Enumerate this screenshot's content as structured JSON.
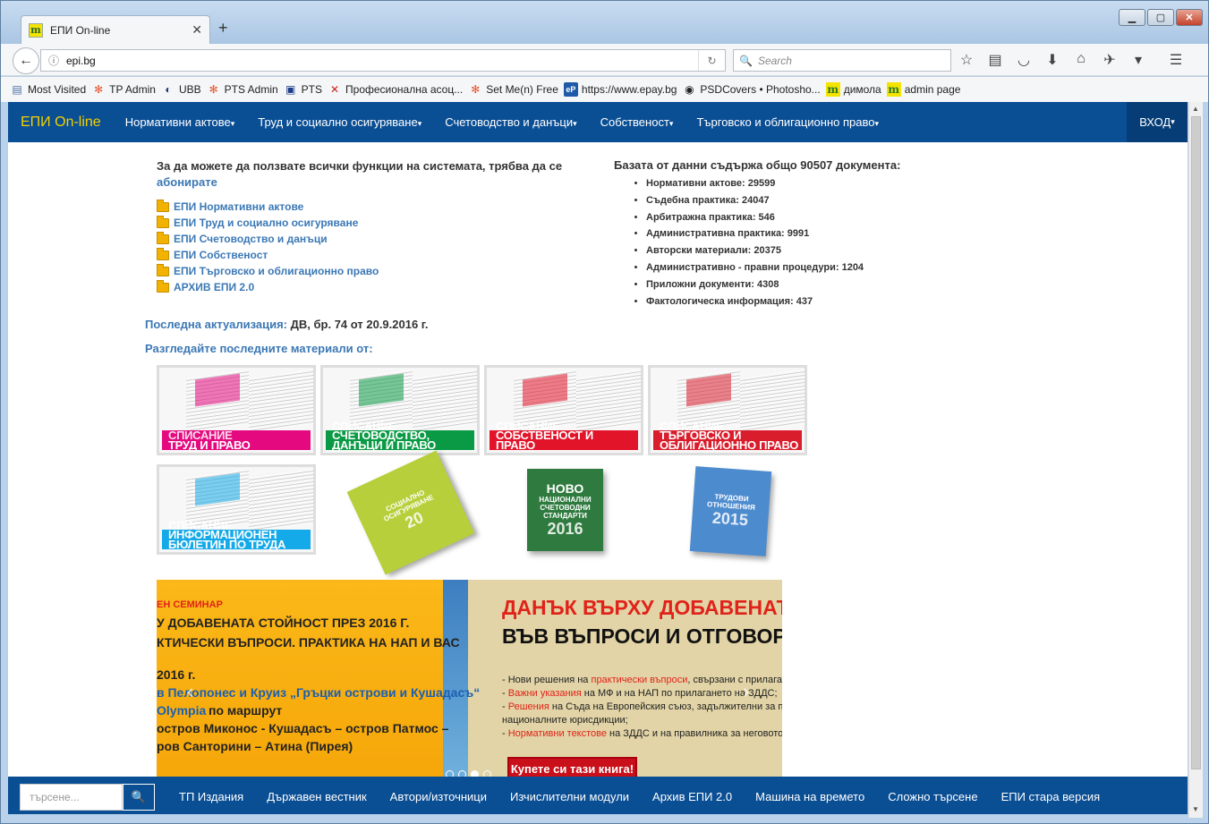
{
  "browser": {
    "tab_title": "ЕПИ On-line",
    "favicon": "m",
    "url": "epi.bg",
    "search_placeholder": "Search"
  },
  "bookmarks": [
    {
      "label": "Most Visited",
      "icon": "bookmark-icon"
    },
    {
      "label": "TP Admin",
      "icon": "joomla-icon"
    },
    {
      "label": "UBB",
      "icon": "ubb-icon"
    },
    {
      "label": "PTS Admin",
      "icon": "joomla-icon"
    },
    {
      "label": "PTS",
      "icon": "pts-icon"
    },
    {
      "label": "Професионална асоц...",
      "icon": "assoc-icon"
    },
    {
      "label": "Set Me(n) Free",
      "icon": "joomla-icon"
    },
    {
      "label": "https://www.epay.bg",
      "icon": "epay-icon"
    },
    {
      "label": "PSDCovers • Photosho...",
      "icon": "psd-icon"
    },
    {
      "label": "димола",
      "icon": "m-icon"
    },
    {
      "label": "admin page",
      "icon": "m-icon"
    }
  ],
  "header": {
    "brand": "ЕПИ On-line",
    "menu": [
      "Нормативни актове",
      "Труд и социално осигуряване",
      "Счетоводство и данъци",
      "Собственост",
      "Търговско и облигационно право"
    ],
    "login": "ВХОД"
  },
  "intro": {
    "text": "За да можете да ползвате всички функции на системата, трябва да се",
    "link": "абонирате"
  },
  "modules": [
    "ЕПИ Нормативни актове",
    "ЕПИ Труд и социално осигуряване",
    "ЕПИ Счетоводство и данъци",
    "ЕПИ Собственост",
    "ЕПИ Търговско и облигационно право",
    "АРХИВ ЕПИ 2.0"
  ],
  "stats": {
    "heading": "Базата от данни съдържа общо 90507 документа:",
    "items": [
      "Нормативни актове: 29599",
      "Съдебна практика: 24047",
      "Арбитражна практика: 546",
      "Административна практика: 9991",
      "Авторски материали: 20375",
      "Административно - правни процедури: 1204",
      "Приложни документи: 4308",
      "Фактологическа информация: 437"
    ]
  },
  "last_update": {
    "label": "Последна актуализация:",
    "value": "ДВ, бр. 74 от 20.9.2016 г."
  },
  "latest_label": "Разгледайте последните материали от:",
  "tiles": [
    {
      "l1": "Списание",
      "l2": "Труд и право",
      "l3": "",
      "color": "#e4097e"
    },
    {
      "l1": "Списание",
      "l2": "Счетоводство,",
      "l3": "данъци и право",
      "color": "#0a9a45"
    },
    {
      "l1": "Списание",
      "l2": "Собственост и",
      "l3": "право",
      "color": "#e2142a"
    },
    {
      "l1": "Списание",
      "l2": "Търговско и",
      "l3": "облигационно право",
      "color": "#d91d2c"
    },
    {
      "l1": "Списание",
      "l2": "Информационен",
      "l3": "бюлетин по труда",
      "color": "#14a9e8"
    }
  ],
  "books": [
    {
      "title": "Социално осигуряване",
      "num": "20",
      "color": "#b7cf3a"
    },
    {
      "title": "Национални счетоводни стандарти",
      "num": "2016",
      "color": "#2f7b3f",
      "top": "НОВО",
      "pre": "2"
    },
    {
      "title": "Трудови отношения",
      "num": "2015",
      "color": "#4d8bcf"
    }
  ],
  "banner": {
    "left_lines": [
      {
        "text": "ЕН СЕМИНАР",
        "style": "red-small"
      },
      {
        "text": "У ДОБАВЕНАТА СТОЙНОСТ ПРЕЗ 2016 Г.",
        "style": "normal"
      },
      {
        "text": "КТИЧЕСКИ ВЪПРОСИ. ПРАКТИКА НА НАП И ВАС",
        "style": "normal"
      },
      {
        "text": "2016 г.",
        "style": "normal"
      },
      {
        "text": "в Пелопонес и Круиз „Гръцки острови и Кушадасъ“",
        "style": "blue"
      },
      {
        "text": "Olympia",
        "style": "blue"
      },
      {
        "text": "по маршрут",
        "style": "normal"
      },
      {
        "text": "остров Миконос - Кушадасъ – остров Патмос –",
        "style": "normal"
      },
      {
        "text": "ров Санторини – Атина (Пирея)",
        "style": "normal"
      }
    ],
    "right_title1": "ДАНЪК ВЪРХУ ДОБАВЕНАТА",
    "right_title2": "ВЪВ ВЪПРОСИ И ОТГОВОРИ",
    "bullets": [
      {
        "pre": "- Нови решения на ",
        "hl": "практически въпроси",
        "post": ", свързани с прилага"
      },
      {
        "pre": "- ",
        "hl": "Важни указания",
        "post": " на МФ и на НАП по прилагането на ЗДДС;"
      },
      {
        "pre": "- ",
        "hl": "Решения",
        "post": " на Съда на Европейския съюз, задължителни за п"
      },
      {
        "pre": "",
        "hl": "",
        "post": "националните юрисдикции;"
      },
      {
        "pre": "- ",
        "hl": "Нормативни текстове",
        "post": " на ЗДДС и на правилника за неговото"
      }
    ],
    "buy": "Купете си тази книга!",
    "active_slide": 3,
    "slides": 4
  },
  "footer": {
    "search_placeholder": "търсене...",
    "links": [
      "ТП Издания",
      "Държавен вестник",
      "Автори/източници",
      "Изчислителни модули",
      "Архив ЕПИ 2.0",
      "Машина на времето",
      "Сложно търсене",
      "ЕПИ стара версия"
    ]
  }
}
